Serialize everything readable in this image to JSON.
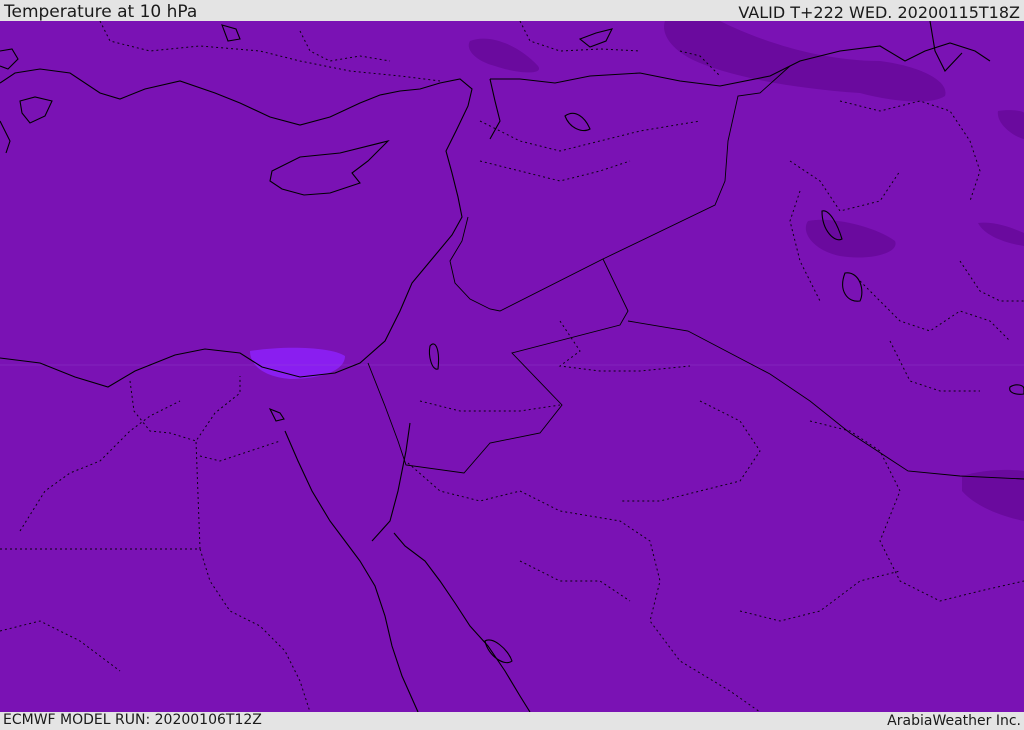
{
  "header": {
    "title": "Temperature at 10 hPa",
    "valid": "VALID T+222 WED. 20200115T18Z"
  },
  "footer": {
    "model_run": "ECMWF MODEL RUN: 20200106T12Z",
    "brand": "ArabiaWeather Inc."
  },
  "map": {
    "field_color": "#7a12b4",
    "colder_patch_color": "#6a0a9e",
    "warmer_patch_color": "#8a1ef0",
    "coastline_color": "#000000"
  }
}
